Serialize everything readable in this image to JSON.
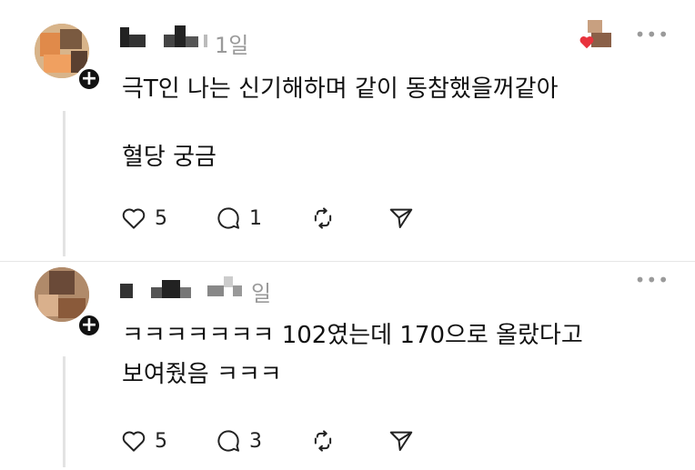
{
  "posts": [
    {
      "time": "1일",
      "more_label": "•••",
      "lines": [
        "극T인 나는 신기해하며 같이 동참했을꺼같아",
        "혈당 궁금"
      ],
      "likes": "5",
      "replies": "1",
      "follow_label": "+"
    },
    {
      "time": "일",
      "more_label": "•••",
      "lines": [
        "ㅋㅋㅋㅋㅋㅋㅋ 102였는데 170으로 올랐다고",
        "보여줬음 ㅋㅋㅋ"
      ],
      "likes": "5",
      "replies": "3",
      "follow_label": "+"
    }
  ],
  "icons": {
    "like": "heart-icon",
    "reply": "comment-icon",
    "repost": "repost-icon",
    "share": "send-icon"
  }
}
